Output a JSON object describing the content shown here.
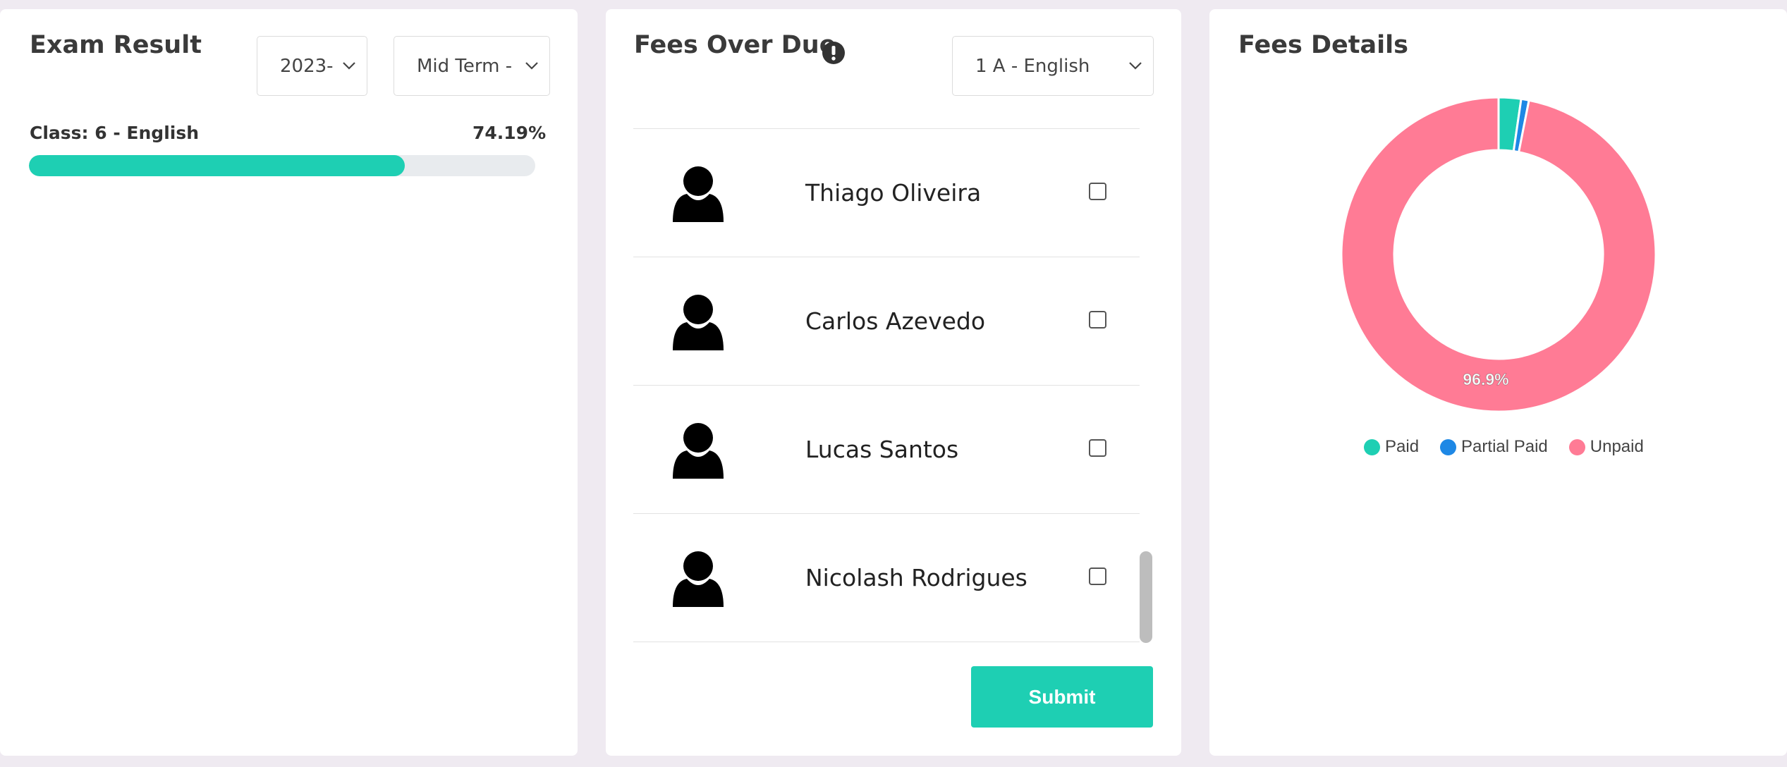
{
  "exam_result": {
    "title": "Exam Result",
    "year_select": "2023-",
    "term_select": "Mid Term -",
    "class_label": "Class: 6 - English",
    "percent_label": "74.19%",
    "progress": 0.7419
  },
  "fees_overdue": {
    "title": "Fees Over Due",
    "class_select": "1 A - English",
    "students": [
      {
        "name": "Thiago Oliveira"
      },
      {
        "name": "Carlos Azevedo"
      },
      {
        "name": "Lucas Santos"
      },
      {
        "name": "Nicolash Rodrigues"
      }
    ],
    "submit_label": "Submit"
  },
  "fees_details": {
    "title": "Fees Details",
    "center_label": "96.9%"
  },
  "chart_data": {
    "type": "pie",
    "variant": "donut",
    "slices": [
      {
        "name": "Paid",
        "value": 2.3,
        "color": "#1ecfb3"
      },
      {
        "name": "Partial Paid",
        "value": 0.8,
        "color": "#1e88e5"
      },
      {
        "name": "Unpaid",
        "value": 96.9,
        "color": "#ff7b95"
      }
    ],
    "data_labels": [
      "96.9%"
    ],
    "legend": [
      "Paid",
      "Partial Paid",
      "Unpaid"
    ],
    "legend_position": "bottom"
  },
  "colors": {
    "accent": "#1ecfb3",
    "partial": "#1e88e5",
    "unpaid": "#ff7b95"
  }
}
